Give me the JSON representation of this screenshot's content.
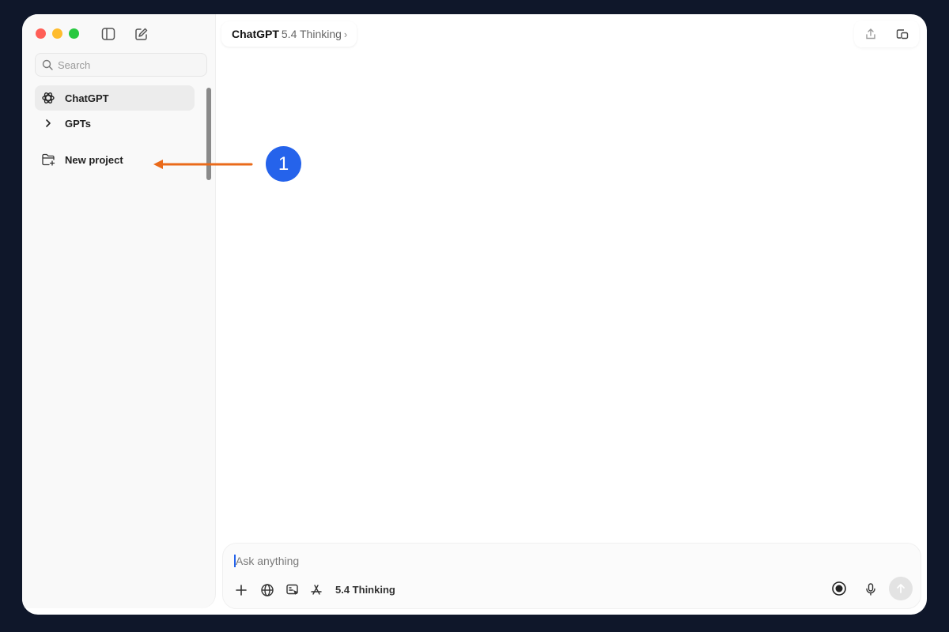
{
  "sidebar": {
    "search_placeholder": "Search",
    "items": [
      {
        "label": "ChatGPT",
        "icon": "openai-logo-icon"
      },
      {
        "label": "GPTs",
        "icon": "chevron-right-icon"
      },
      {
        "label": "New project",
        "icon": "new-folder-icon"
      }
    ]
  },
  "header": {
    "brand": "ChatGPT",
    "variant": "5.4 Thinking",
    "chevron": "›"
  },
  "composer": {
    "placeholder": "Ask anything",
    "model_label": "5.4 Thinking"
  },
  "annotation": {
    "step_number": "1",
    "arrow_color": "#ea6a1a",
    "badge_color": "#2563eb"
  }
}
